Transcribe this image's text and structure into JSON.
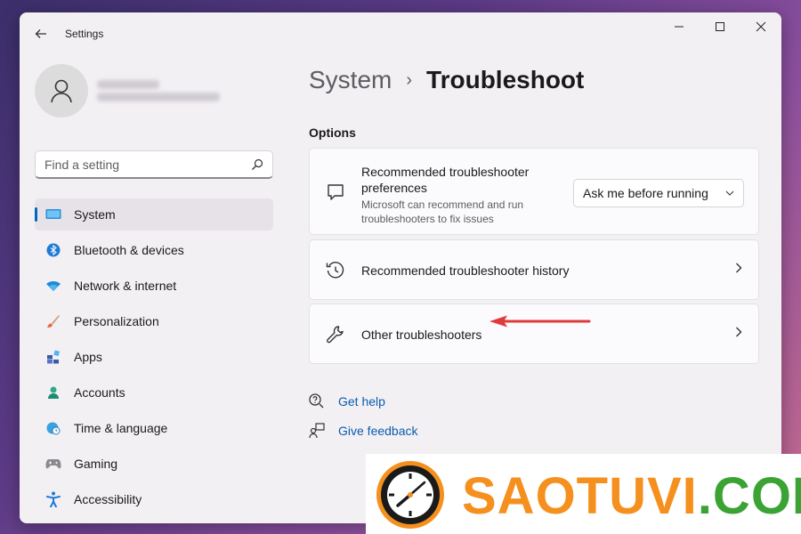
{
  "window": {
    "title": "Settings"
  },
  "sidebar": {
    "search_placeholder": "Find a setting",
    "items": [
      {
        "label": "System",
        "icon": "monitor-icon",
        "active": true
      },
      {
        "label": "Bluetooth & devices",
        "icon": "bluetooth-icon"
      },
      {
        "label": "Network & internet",
        "icon": "wifi-icon"
      },
      {
        "label": "Personalization",
        "icon": "brush-icon"
      },
      {
        "label": "Apps",
        "icon": "apps-icon"
      },
      {
        "label": "Accounts",
        "icon": "person-icon"
      },
      {
        "label": "Time & language",
        "icon": "globe-clock-icon"
      },
      {
        "label": "Gaming",
        "icon": "gamepad-icon"
      },
      {
        "label": "Accessibility",
        "icon": "accessibility-icon"
      }
    ]
  },
  "main": {
    "breadcrumb": {
      "parent": "System",
      "current": "Troubleshoot"
    },
    "section_label": "Options",
    "cards": [
      {
        "title": "Recommended troubleshooter preferences",
        "description": "Microsoft can recommend and run troubleshooters to fix issues",
        "dropdown_value": "Ask me before running",
        "icon": "chat-icon"
      },
      {
        "title": "Recommended troubleshooter history",
        "icon": "history-icon"
      },
      {
        "title": "Other troubleshooters",
        "icon": "wrench-icon"
      }
    ],
    "links": [
      {
        "label": "Get help",
        "icon": "help-icon"
      },
      {
        "label": "Give feedback",
        "icon": "feedback-icon"
      }
    ]
  },
  "watermark": {
    "text": "SAOTUVI.COM",
    "colors": {
      "orange": "#f5901e",
      "green": "#3aa334"
    }
  },
  "colors": {
    "accent": "#0067c0",
    "annotation_arrow": "#e03a3a"
  }
}
